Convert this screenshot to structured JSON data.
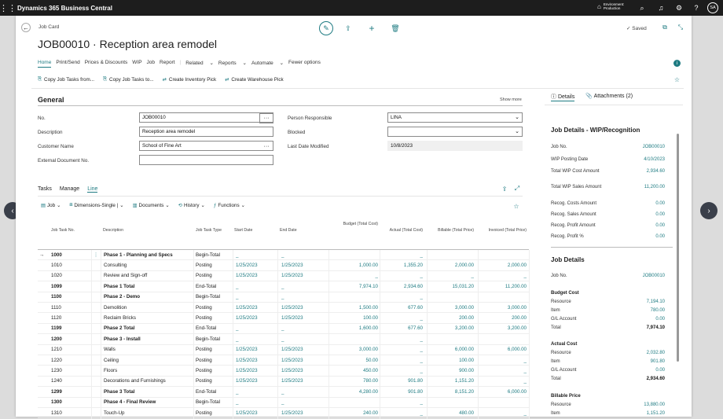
{
  "topbar": {
    "app_name": "Dynamics 365 Business Central",
    "env_line1": "Environment:",
    "env_line2": "Production",
    "avatar": "SA"
  },
  "header": {
    "breadcrumb": "Job Card",
    "title": "JOB00010 · Reception area remodel",
    "saved": "Saved"
  },
  "actions": [
    "Home",
    "Print/Send",
    "Prices & Discounts",
    "WIP",
    "Job",
    "Report",
    "Related",
    "Reports",
    "Automate",
    "Fewer options"
  ],
  "promoted": [
    "Copy Job Tasks from...",
    "Copy Job Tasks to...",
    "Create Inventory Pick",
    "Create Warehouse Pick"
  ],
  "general": {
    "title": "General",
    "show_more": "Show more",
    "no_label": "No.",
    "no_value": "JOB00010",
    "desc_label": "Description",
    "desc_value": "Reception area remodel",
    "cust_label": "Customer Name",
    "cust_value": "School of Fine Art",
    "ext_label": "External Document No.",
    "ext_value": "",
    "person_label": "Person Responsible",
    "person_value": "LINA",
    "blocked_label": "Blocked",
    "blocked_value": "",
    "lastmod_label": "Last Date Modified",
    "lastmod_value": "10/8/2023"
  },
  "tasks": {
    "tabs": [
      "Tasks",
      "Manage",
      "Line"
    ],
    "actions": [
      "Job",
      "Dimensions-Single",
      "Documents",
      "History",
      "Functions"
    ],
    "columns": [
      "Job Task No.",
      "Description",
      "Job Task Type",
      "Start Date",
      "End Date",
      "Budget (Total Cost)",
      "Actual (Total Cost)",
      "Billable (Total Price)",
      "Invoiced (Total Price)"
    ],
    "rows": [
      [
        "1000",
        "Phase 1 - Planning and Specs",
        "Begin-Total",
        "_",
        "_",
        "",
        "_",
        "",
        ""
      ],
      [
        "1010",
        "Consulting",
        "Posting",
        "1/25/2023",
        "1/25/2023",
        "1,000.00",
        "1,355.20",
        "2,000.00",
        "2,000.00"
      ],
      [
        "1020",
        "Review and Sign-off",
        "Posting",
        "1/25/2023",
        "1/25/2023",
        "_",
        "_",
        "_",
        "_"
      ],
      [
        "1099",
        "Phase 1 Total",
        "End-Total",
        "_",
        "_",
        "7,974.10",
        "2,934.60",
        "15,031.20",
        "11,200.00"
      ],
      [
        "1100",
        "Phase 2 - Demo",
        "Begin-Total",
        "_",
        "_",
        "",
        "_",
        "",
        ""
      ],
      [
        "1110",
        "Demolition",
        "Posting",
        "1/25/2023",
        "1/25/2023",
        "1,500.00",
        "677.60",
        "3,000.00",
        "3,000.00"
      ],
      [
        "1120",
        "Reclaim Bricks",
        "Posting",
        "1/25/2023",
        "1/25/2023",
        "100.00",
        "_",
        "200.00",
        "200.00"
      ],
      [
        "1199",
        "Phase 2 Total",
        "End-Total",
        "_",
        "_",
        "1,600.00",
        "677.60",
        "3,200.00",
        "3,200.00"
      ],
      [
        "1200",
        "Phase 3 - Install",
        "Begin-Total",
        "_",
        "_",
        "",
        "_",
        "",
        ""
      ],
      [
        "1210",
        "Walls",
        "Posting",
        "1/25/2023",
        "1/25/2023",
        "3,000.00",
        "_",
        "6,000.00",
        "6,000.00"
      ],
      [
        "1220",
        "Ceiling",
        "Posting",
        "1/25/2023",
        "1/25/2023",
        "50.00",
        "_",
        "100.00",
        "_"
      ],
      [
        "1230",
        "Floors",
        "Posting",
        "1/25/2023",
        "1/25/2023",
        "450.00",
        "_",
        "900.00",
        "_"
      ],
      [
        "1240",
        "Decorations and Furnishings",
        "Posting",
        "1/25/2023",
        "1/25/2023",
        "780.00",
        "901.80",
        "1,151.20",
        "_"
      ],
      [
        "1299",
        "Phase 3 Total",
        "End-Total",
        "_",
        "_",
        "4,280.00",
        "901.80",
        "8,151.20",
        "6,000.00"
      ],
      [
        "1300",
        "Phase 4 - Final Review",
        "Begin-Total",
        "_",
        "_",
        "",
        "_",
        "",
        ""
      ],
      [
        "1310",
        "Touch-Up",
        "Posting",
        "1/25/2023",
        "1/25/2023",
        "240.00",
        "_",
        "480.00",
        "_"
      ]
    ]
  },
  "details": {
    "tab_details": "Details",
    "tab_attach": "Attachments (2)",
    "wip_title": "Job Details - WIP/Recognition",
    "wip": [
      [
        "Job No.",
        "JOB00010"
      ],
      [
        "WIP Posting Date",
        "4/10/2023"
      ],
      [
        "Total WIP Cost Amount",
        "2,934.60"
      ],
      [
        "Total WIP Sales Amount",
        "11,200.00"
      ],
      [
        "Recog. Costs Amount",
        "0.00"
      ],
      [
        "Recog. Sales Amount",
        "0.00"
      ],
      [
        "Recog. Profit Amount",
        "0.00"
      ],
      [
        "Recog. Profit %",
        "0.00"
      ]
    ],
    "jd_title": "Job Details",
    "jd_no_label": "Job No.",
    "jd_no": "JOB00010",
    "budget_title": "Budget Cost",
    "budget": [
      [
        "Resource",
        "7,194.10"
      ],
      [
        "Item",
        "780.00"
      ],
      [
        "G/L Account",
        "0.00"
      ],
      [
        "Total",
        "7,974.10"
      ]
    ],
    "actual_title": "Actual Cost",
    "actual": [
      [
        "Resource",
        "2,032.80"
      ],
      [
        "Item",
        "901.80"
      ],
      [
        "G/L Account",
        "0.00"
      ],
      [
        "Total",
        "2,934.60"
      ]
    ],
    "billable_title": "Billable Price",
    "billable": [
      [
        "Resource",
        "13,880.00"
      ],
      [
        "Item",
        "1,151.20"
      ]
    ]
  }
}
